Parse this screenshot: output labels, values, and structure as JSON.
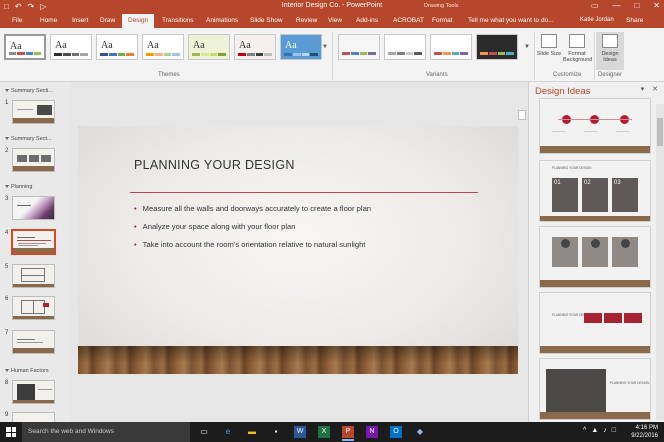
{
  "window": {
    "doc_title": "Interior Design Co. - PowerPoint",
    "context_tab_group": "Drawing Tools",
    "user_name": "Katie Jordan",
    "share_label": "Share",
    "qat_icons": [
      "save-icon",
      "undo-icon",
      "redo-icon",
      "present-icon"
    ]
  },
  "ribbon_tabs": [
    "File",
    "Home",
    "Insert",
    "Draw",
    "Design",
    "Transitions",
    "Animations",
    "Slide Show",
    "Review",
    "View",
    "Add-ins",
    "ACROBAT",
    "Format"
  ],
  "active_tab": "Design",
  "tell_me": "Tell me what you want to do...",
  "themes": {
    "label": "Themes",
    "items": [
      {
        "glyph": "Aa",
        "bg": "#ffffff",
        "bars": [
          "#8b8b8b",
          "#c0504d",
          "#4f81bd",
          "#9bbb59"
        ]
      },
      {
        "glyph": "Aa",
        "bg": "#ffffff",
        "bars": [
          "#2d2d2d",
          "#4c4c4c",
          "#707070",
          "#a5a5a5"
        ]
      },
      {
        "glyph": "Aa",
        "bg": "#ffffff",
        "bars": [
          "#2f5597",
          "#4472c4",
          "#70ad47",
          "#ed7d31"
        ]
      },
      {
        "glyph": "Aa",
        "bg": "#ffffff",
        "bars": [
          "#e7a100",
          "#f4b183",
          "#a9d18e",
          "#9dc3e6"
        ]
      },
      {
        "glyph": "Aa",
        "bg": "#eef3d8",
        "bars": [
          "#9bbb59",
          "#d8e4a8",
          "#c9d96a",
          "#7f9f36"
        ]
      },
      {
        "glyph": "Aa",
        "bg": "#f4f0f0",
        "bars": [
          "#c00000",
          "#7f7f7f",
          "#404040",
          "#bfbfbf"
        ]
      },
      {
        "glyph": "Aa",
        "bg": "#5b9bd5",
        "bars": [
          "#2e75b6",
          "#9dc3e6",
          "#bdd7ee",
          "#1f4e79"
        ]
      }
    ]
  },
  "variants": {
    "label": "Variants",
    "items": [
      {
        "bg": "#f6f6f6",
        "bars": [
          "#c0504d",
          "#4f81bd",
          "#9bbb59",
          "#8064a2"
        ]
      },
      {
        "bg": "#ffffff",
        "bars": [
          "#a5a5a5",
          "#7f7f7f",
          "#c9c9c9",
          "#595959"
        ]
      },
      {
        "bg": "#ffffff",
        "bars": [
          "#c0504d",
          "#f79646",
          "#4bacc6",
          "#8064a2"
        ]
      },
      {
        "bg": "#2b2b2b",
        "bars": [
          "#f79646",
          "#c0504d",
          "#9bbb59",
          "#4bacc6"
        ]
      }
    ]
  },
  "customize": {
    "label": "Customize",
    "slide_size": "Slide Size",
    "format_background": "Format Background"
  },
  "designer": {
    "label": "Designer",
    "design_ideas": "Design Ideas"
  },
  "slide_panel": {
    "sections": [
      "Summary Secti...",
      "Summary Sect...",
      "Planning",
      "Human Factors"
    ],
    "slide_numbers": [
      "1",
      "2",
      "3",
      "4",
      "5",
      "6",
      "7",
      "8",
      "9"
    ],
    "selected_slide": "4"
  },
  "slide": {
    "title": "PLANNING YOUR DESIGN",
    "bullets": [
      "Measure all the walls and doorways accurately to create a floor plan",
      "Analyze your space along with your floor plan",
      "Take into account the room’s orientation relative to natural sunlight"
    ],
    "accent": "#c0464b"
  },
  "design_ideas_pane": {
    "title": "Design Ideas",
    "idea_title": "PLANNING YOUR DESIGN",
    "numbers": [
      "01",
      "02",
      "03"
    ]
  },
  "taskbar": {
    "search": "Search the web and Windows",
    "time": "4:16 PM",
    "date": "9/22/2016"
  }
}
